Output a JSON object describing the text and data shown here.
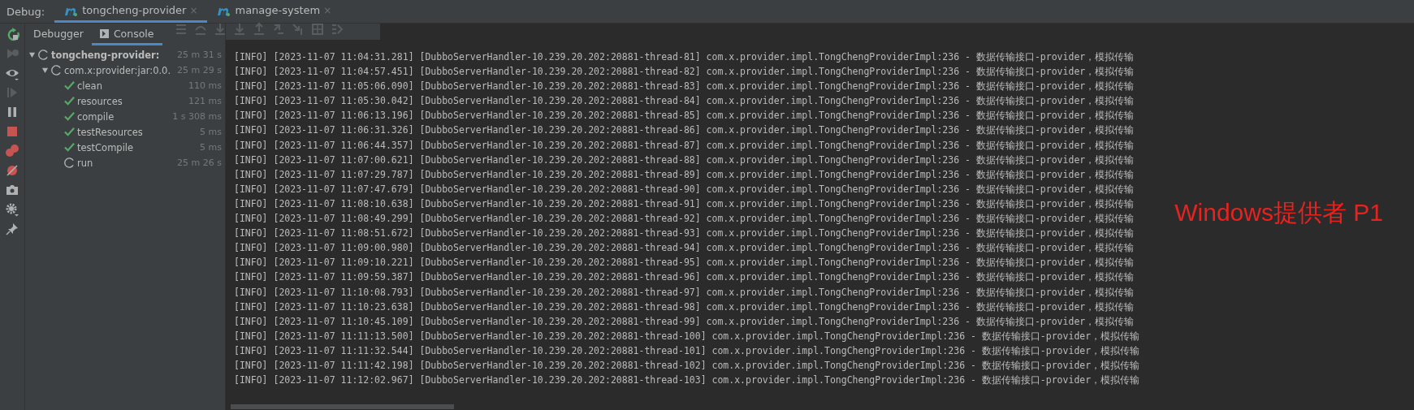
{
  "debug_bar": {
    "label": "Debug:",
    "tabs": [
      {
        "label": "tongcheng-provider",
        "selected": true,
        "close": "×"
      },
      {
        "label": "manage-system",
        "selected": false,
        "close": "×"
      }
    ]
  },
  "sub_tabs": [
    {
      "label": "Debugger",
      "selected": false
    },
    {
      "label": "Console",
      "selected": true
    }
  ],
  "tree": [
    {
      "label": "tongcheng-provider:",
      "time": "25 m 31 s",
      "kind": "running",
      "expanded": true,
      "children": [
        {
          "label": "com.x:provider:jar:0.0.",
          "time": "25 m 29 s",
          "kind": "running",
          "expanded": true,
          "children": [
            {
              "label": "clean",
              "time": "110 ms",
              "kind": "done"
            },
            {
              "label": "resources",
              "time": "121 ms",
              "kind": "done"
            },
            {
              "label": "compile",
              "time": "1 s 308 ms",
              "kind": "done"
            },
            {
              "label": "testResources",
              "time": "5 ms",
              "kind": "done"
            },
            {
              "label": "testCompile",
              "time": "5 ms",
              "kind": "done"
            },
            {
              "label": "run",
              "time": "25 m 26 s",
              "kind": "running"
            }
          ]
        }
      ]
    }
  ],
  "console_lines": [
    "[INFO] [2023-11-07 11:04:31.281] [DubboServerHandler-10.239.20.202:20881-thread-81] com.x.provider.impl.TongChengProviderImpl:236 - 数据传输接口-provider，模拟传输",
    "[INFO] [2023-11-07 11:04:57.451] [DubboServerHandler-10.239.20.202:20881-thread-82] com.x.provider.impl.TongChengProviderImpl:236 - 数据传输接口-provider，模拟传输",
    "[INFO] [2023-11-07 11:05:06.090] [DubboServerHandler-10.239.20.202:20881-thread-83] com.x.provider.impl.TongChengProviderImpl:236 - 数据传输接口-provider，模拟传输",
    "[INFO] [2023-11-07 11:05:30.042] [DubboServerHandler-10.239.20.202:20881-thread-84] com.x.provider.impl.TongChengProviderImpl:236 - 数据传输接口-provider，模拟传输",
    "[INFO] [2023-11-07 11:06:13.196] [DubboServerHandler-10.239.20.202:20881-thread-85] com.x.provider.impl.TongChengProviderImpl:236 - 数据传输接口-provider，模拟传输",
    "[INFO] [2023-11-07 11:06:31.326] [DubboServerHandler-10.239.20.202:20881-thread-86] com.x.provider.impl.TongChengProviderImpl:236 - 数据传输接口-provider，模拟传输",
    "[INFO] [2023-11-07 11:06:44.357] [DubboServerHandler-10.239.20.202:20881-thread-87] com.x.provider.impl.TongChengProviderImpl:236 - 数据传输接口-provider，模拟传输",
    "[INFO] [2023-11-07 11:07:00.621] [DubboServerHandler-10.239.20.202:20881-thread-88] com.x.provider.impl.TongChengProviderImpl:236 - 数据传输接口-provider，模拟传输",
    "[INFO] [2023-11-07 11:07:29.787] [DubboServerHandler-10.239.20.202:20881-thread-89] com.x.provider.impl.TongChengProviderImpl:236 - 数据传输接口-provider，模拟传输",
    "[INFO] [2023-11-07 11:07:47.679] [DubboServerHandler-10.239.20.202:20881-thread-90] com.x.provider.impl.TongChengProviderImpl:236 - 数据传输接口-provider，模拟传输",
    "[INFO] [2023-11-07 11:08:10.638] [DubboServerHandler-10.239.20.202:20881-thread-91] com.x.provider.impl.TongChengProviderImpl:236 - 数据传输接口-provider，模拟传输",
    "[INFO] [2023-11-07 11:08:49.299] [DubboServerHandler-10.239.20.202:20881-thread-92] com.x.provider.impl.TongChengProviderImpl:236 - 数据传输接口-provider，模拟传输",
    "[INFO] [2023-11-07 11:08:51.672] [DubboServerHandler-10.239.20.202:20881-thread-93] com.x.provider.impl.TongChengProviderImpl:236 - 数据传输接口-provider，模拟传输",
    "[INFO] [2023-11-07 11:09:00.980] [DubboServerHandler-10.239.20.202:20881-thread-94] com.x.provider.impl.TongChengProviderImpl:236 - 数据传输接口-provider，模拟传输",
    "[INFO] [2023-11-07 11:09:10.221] [DubboServerHandler-10.239.20.202:20881-thread-95] com.x.provider.impl.TongChengProviderImpl:236 - 数据传输接口-provider，模拟传输",
    "[INFO] [2023-11-07 11:09:59.387] [DubboServerHandler-10.239.20.202:20881-thread-96] com.x.provider.impl.TongChengProviderImpl:236 - 数据传输接口-provider，模拟传输",
    "[INFO] [2023-11-07 11:10:08.793] [DubboServerHandler-10.239.20.202:20881-thread-97] com.x.provider.impl.TongChengProviderImpl:236 - 数据传输接口-provider，模拟传输",
    "[INFO] [2023-11-07 11:10:23.638] [DubboServerHandler-10.239.20.202:20881-thread-98] com.x.provider.impl.TongChengProviderImpl:236 - 数据传输接口-provider，模拟传输",
    "[INFO] [2023-11-07 11:10:45.109] [DubboServerHandler-10.239.20.202:20881-thread-99] com.x.provider.impl.TongChengProviderImpl:236 - 数据传输接口-provider，模拟传输",
    "[INFO] [2023-11-07 11:11:13.500] [DubboServerHandler-10.239.20.202:20881-thread-100] com.x.provider.impl.TongChengProviderImpl:236 - 数据传输接口-provider，模拟传输",
    "[INFO] [2023-11-07 11:11:32.544] [DubboServerHandler-10.239.20.202:20881-thread-101] com.x.provider.impl.TongChengProviderImpl:236 - 数据传输接口-provider，模拟传输",
    "[INFO] [2023-11-07 11:11:42.198] [DubboServerHandler-10.239.20.202:20881-thread-102] com.x.provider.impl.TongChengProviderImpl:236 - 数据传输接口-provider，模拟传输",
    "[INFO] [2023-11-07 11:12:02.967] [DubboServerHandler-10.239.20.202:20881-thread-103] com.x.provider.impl.TongChengProviderImpl:236 - 数据传输接口-provider，模拟传输"
  ],
  "annotation": "Windows提供者 P1"
}
